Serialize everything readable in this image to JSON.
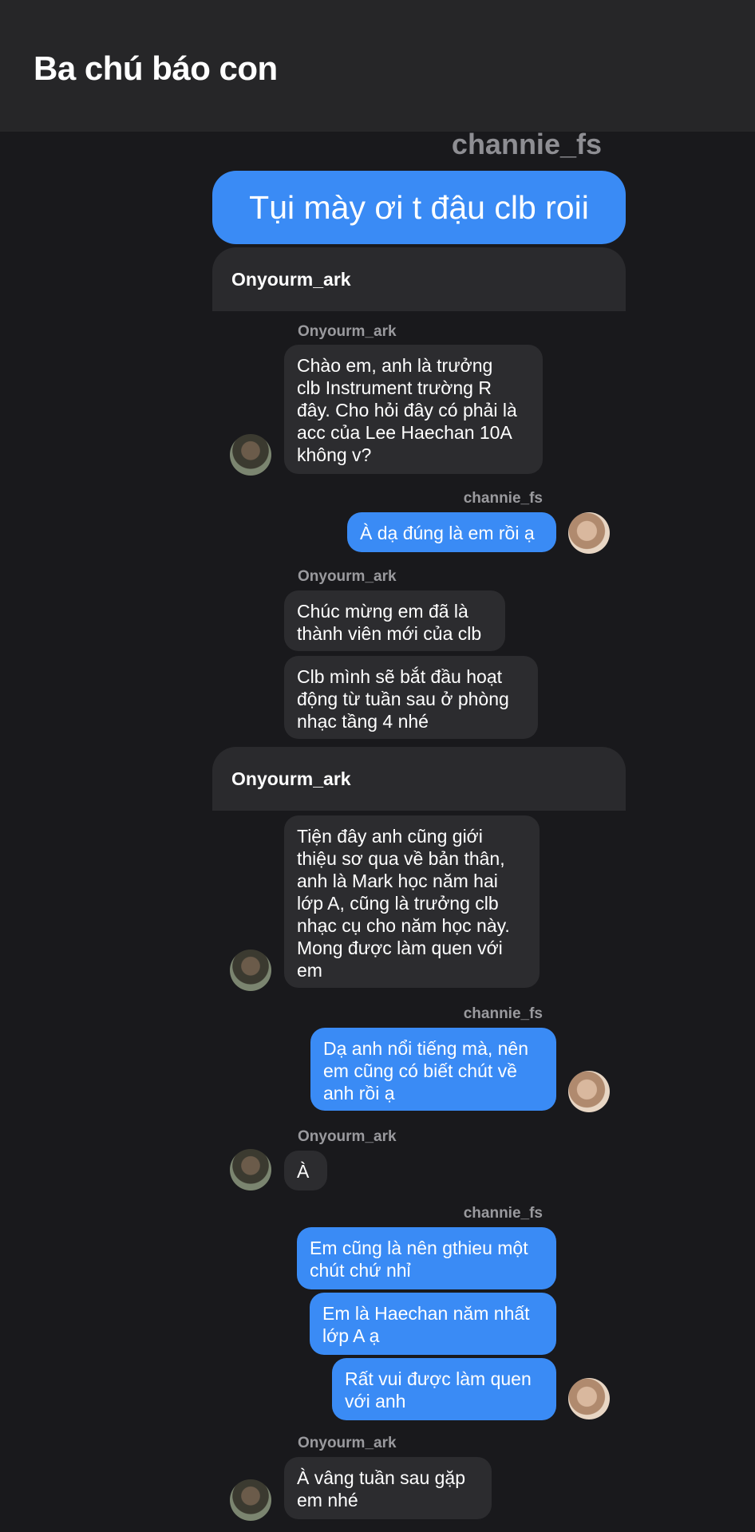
{
  "header": {
    "title": "Ba chú báo con"
  },
  "top": {
    "sender": "channie_fs",
    "message": "Tụi mày ơi t đậu clb roii"
  },
  "cards": [
    {
      "name": "Onyourm_ark"
    },
    {
      "name": "Onyourm_ark"
    }
  ],
  "messages": [
    {
      "sender": "Onyourm_ark",
      "text": "Chào em, anh là trưởng\nclb Instrument trường R\nđây. Cho hỏi đây có phải là\nacc của Lee Haechan 10A\nkhông v?"
    },
    {
      "sender": "channie_fs",
      "text": "À dạ đúng là em rồi ạ"
    },
    {
      "sender": "Onyourm_ark",
      "text": "Chúc mừng em đã là\nthành viên mới của clb"
    },
    {
      "text": "Clb mình sẽ bắt đầu hoạt\nđộng từ tuần sau ở phòng\nnhạc tầng 4 nhé"
    },
    {
      "text": "Tiện đây anh cũng giới\nthiệu sơ qua về bản thân,\nanh là Mark học năm hai\nlớp A, cũng là trưởng clb\nnhạc cụ cho năm học này.\nMong được làm quen với\nem"
    },
    {
      "sender": "channie_fs",
      "text": "Dạ anh nổi tiếng mà, nên\nem cũng có biết chút về\nanh rồi ạ"
    },
    {
      "sender": "Onyourm_ark",
      "text": "À"
    },
    {
      "sender": "channie_fs",
      "text": "Em cũng là nên gthieu một\nchút chứ nhỉ"
    },
    {
      "text": "Em là Haechan năm nhất\nlớp A ạ"
    },
    {
      "text": "Rất vui được làm quen\nvới anh"
    },
    {
      "sender": "Onyourm_ark",
      "text": "À vâng tuần sau gặp\nem nhé"
    }
  ]
}
